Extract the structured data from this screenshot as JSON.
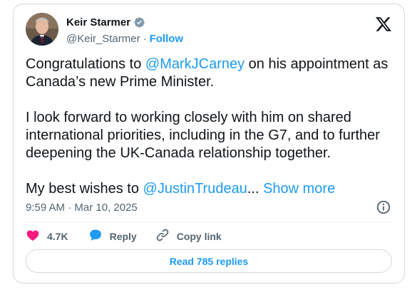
{
  "author": {
    "name": "Keir Starmer",
    "handle": "@Keir_Starmer",
    "separator": "·",
    "follow_label": "Follow"
  },
  "tweet": {
    "p1_before": "Congratulations to ",
    "p1_mention": "@MarkJCarney",
    "p1_after": " on his appointment as Canada’s new Prime Minister.",
    "p2": "I look forward to working closely with him on shared international priorities, including in the G7, and to further deepening the UK-Canada relationship together.",
    "p3_before": "My best wishes to ",
    "p3_mention": "@JustinTrudeau",
    "p3_ellipsis": "...",
    "show_more": "Show more"
  },
  "timestamp": "9:59 AM · Mar 10, 2025",
  "actions": {
    "likes": "4.7K",
    "reply_label": "Reply",
    "copy_label": "Copy link"
  },
  "read_replies_label": "Read 785 replies",
  "colors": {
    "accent": "#1d9bf0",
    "like": "#f91880",
    "text": "#0f1419",
    "muted": "#536471",
    "verified": "#829aab"
  },
  "icons": [
    "verified-badge-icon",
    "x-logo-icon",
    "info-icon",
    "heart-icon",
    "reply-bubble-icon",
    "link-icon"
  ]
}
